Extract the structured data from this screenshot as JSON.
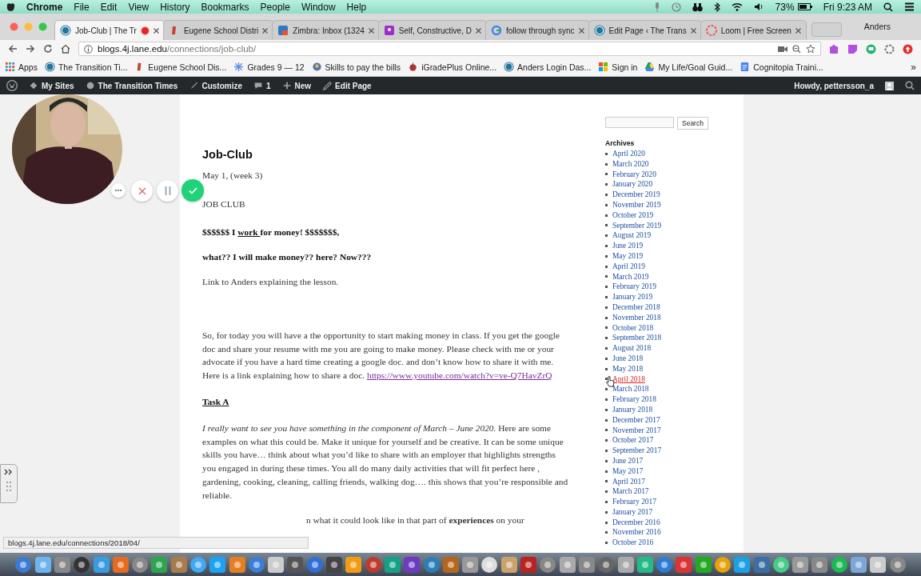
{
  "menubar": {
    "app": "Chrome",
    "menus": [
      "File",
      "Edit",
      "View",
      "History",
      "Bookmarks",
      "People",
      "Window",
      "Help"
    ],
    "battery": "73%",
    "clock": "Fri 9:23 AM"
  },
  "tabs": [
    {
      "title": "Job-Club | The Tr",
      "kind": "wp",
      "selected": true,
      "recording": true
    },
    {
      "title": "Eugene School Distri",
      "kind": "eugene",
      "selected": false,
      "recording": false
    },
    {
      "title": "Zimbra: Inbox (1324",
      "kind": "zimbra",
      "selected": false,
      "recording": false
    },
    {
      "title": "Self, Constructive, D",
      "kind": "purple",
      "selected": false,
      "recording": false
    },
    {
      "title": "follow through sync",
      "kind": "google",
      "selected": false,
      "recording": false
    },
    {
      "title": "Edit Page ‹ The Trans",
      "kind": "wp",
      "selected": false,
      "recording": false
    },
    {
      "title": "Loom | Free Screen",
      "kind": "loom",
      "selected": false,
      "recording": false
    }
  ],
  "profile": "Anders",
  "address": {
    "host": "blogs.4j.lane.edu",
    "path": "/connections/job-club/"
  },
  "bookmarks": [
    {
      "label": "Apps",
      "kind": "apps"
    },
    {
      "label": "The Transition Ti...",
      "kind": "wp"
    },
    {
      "label": "Eugene School Dis...",
      "kind": "eugene"
    },
    {
      "label": "Grades 9 — 12",
      "kind": "star"
    },
    {
      "label": "Skills to pay the bills",
      "kind": "globe"
    },
    {
      "label": "iGradePlus Online...",
      "kind": "apple"
    },
    {
      "label": "Anders Login Das...",
      "kind": "wp"
    },
    {
      "label": "Sign in",
      "kind": "ms"
    },
    {
      "label": "My Life/Goal Guid...",
      "kind": "drive"
    },
    {
      "label": "Cognitopia Traini...",
      "kind": "doc"
    }
  ],
  "bookmarks_more": "»",
  "adminbar": {
    "items": [
      {
        "label": "My Sites",
        "kind": "sites"
      },
      {
        "label": "The Transition Times",
        "kind": "home"
      },
      {
        "label": "Customize",
        "kind": "brush"
      },
      {
        "label": "1",
        "kind": "comment"
      },
      {
        "label": "New",
        "kind": "plus"
      },
      {
        "label": "Edit Page",
        "kind": "pencil"
      }
    ],
    "greeting": "Howdy, pettersson_a"
  },
  "post": {
    "title": "Job-Club",
    "date": "May 1, (week 3)",
    "heading": "JOB CLUB",
    "money_line": [
      {
        "text": "$$$$$$ I ",
        "underlined": false
      },
      {
        "text": "work ",
        "underlined": true
      },
      {
        "text": "for money! $$$$$$$,",
        "underlined": false
      }
    ],
    "question": "what?? I will make money??  here?   Now???",
    "link_line": "Link to Anders explaining the lesson.",
    "intro": "So, for today you will have a the opportunity to start making money in class. If you get the google doc and share your resume with me you are going to make money. Please check with me or your advocate if you have a hard time creating a google doc. and don’t know how to share it with me. Here is a link explaining how to share a doc.",
    "video_link": "https://www.youtube.com/watch?v=ve-Q7HavZrQ",
    "task": "Task A",
    "task_text": "*I really want to see you have something in the component of March – June 2020.* Here are some examples on what this could be. Make it unique for yourself and be creative. It can be some unique skills you have… think about what you’d like to share with an employer that highlights strengths you engaged in during these times. You all do many daily activities that will fit perfect here , gardening, cooking, cleaning, calling friends, walking dog…. this shows that you’re responsible and reliable.",
    "cut_line": "n what it could look like in that part of **experiences** on your"
  },
  "sidebar": {
    "search_button": "Search",
    "archives_title": "Archives",
    "archives": [
      {
        "label": "April 2020",
        "hovered": false
      },
      {
        "label": "March 2020",
        "hovered": false
      },
      {
        "label": "February 2020",
        "hovered": false
      },
      {
        "label": "January 2020",
        "hovered": false
      },
      {
        "label": "December 2019",
        "hovered": false
      },
      {
        "label": "November 2019",
        "hovered": false
      },
      {
        "label": "October 2019",
        "hovered": false
      },
      {
        "label": "September 2019",
        "hovered": false
      },
      {
        "label": "August 2019",
        "hovered": false
      },
      {
        "label": "June 2019",
        "hovered": false
      },
      {
        "label": "May 2019",
        "hovered": false
      },
      {
        "label": "April 2019",
        "hovered": false
      },
      {
        "label": "March 2019",
        "hovered": false
      },
      {
        "label": "February 2019",
        "hovered": false
      },
      {
        "label": "January 2019",
        "hovered": false
      },
      {
        "label": "December 2018",
        "hovered": false
      },
      {
        "label": "November 2018",
        "hovered": false
      },
      {
        "label": "October 2018",
        "hovered": false
      },
      {
        "label": "September 2018",
        "hovered": false
      },
      {
        "label": "August 2018",
        "hovered": false
      },
      {
        "label": "June 2018",
        "hovered": false
      },
      {
        "label": "May 2018",
        "hovered": false
      },
      {
        "label": "April 2018",
        "hovered": true
      },
      {
        "label": "March 2018",
        "hovered": false
      },
      {
        "label": "February 2018",
        "hovered": false
      },
      {
        "label": "January 2018",
        "hovered": false
      },
      {
        "label": "December 2017",
        "hovered": false
      },
      {
        "label": "November 2017",
        "hovered": false
      },
      {
        "label": "October 2017",
        "hovered": false
      },
      {
        "label": "September 2017",
        "hovered": false
      },
      {
        "label": "June 2017",
        "hovered": false
      },
      {
        "label": "May 2017",
        "hovered": false
      },
      {
        "label": "April 2017",
        "hovered": false
      },
      {
        "label": "March 2017",
        "hovered": false
      },
      {
        "label": "February 2017",
        "hovered": false
      },
      {
        "label": "January 2017",
        "hovered": false
      },
      {
        "label": "December 2016",
        "hovered": false
      },
      {
        "label": "November 2016",
        "hovered": false
      },
      {
        "label": "October 2016",
        "hovered": false
      }
    ]
  },
  "status_url": "blogs.4j.lane.edu/connections/2018/04/"
}
